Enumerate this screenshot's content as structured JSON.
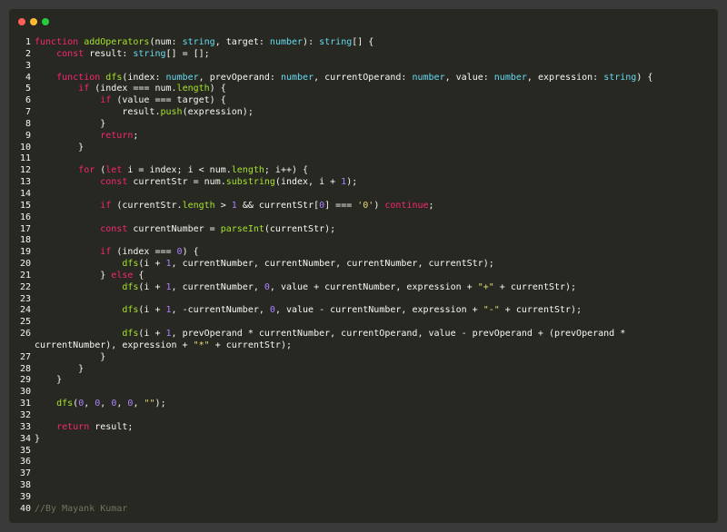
{
  "window": {
    "controls": [
      "close",
      "minimize",
      "maximize"
    ]
  },
  "code": {
    "lines": [
      {
        "n": "1",
        "t": "function addOperators(num: string, target: number): string[] {"
      },
      {
        "n": "2",
        "t": "    const result: string[] = [];"
      },
      {
        "n": "3",
        "t": ""
      },
      {
        "n": "4",
        "t": "    function dfs(index: number, prevOperand: number, currentOperand: number, value: number, expression: string) {"
      },
      {
        "n": "5",
        "t": "        if (index === num.length) {"
      },
      {
        "n": "6",
        "t": "            if (value === target) {"
      },
      {
        "n": "7",
        "t": "                result.push(expression);"
      },
      {
        "n": "8",
        "t": "            }"
      },
      {
        "n": "9",
        "t": "            return;"
      },
      {
        "n": "10",
        "t": "        }"
      },
      {
        "n": "11",
        "t": ""
      },
      {
        "n": "12",
        "t": "        for (let i = index; i < num.length; i++) {"
      },
      {
        "n": "13",
        "t": "            const currentStr = num.substring(index, i + 1);"
      },
      {
        "n": "14",
        "t": ""
      },
      {
        "n": "15",
        "t": "            if (currentStr.length > 1 && currentStr[0] === '0') continue;"
      },
      {
        "n": "16",
        "t": ""
      },
      {
        "n": "17",
        "t": "            const currentNumber = parseInt(currentStr);"
      },
      {
        "n": "18",
        "t": ""
      },
      {
        "n": "19",
        "t": "            if (index === 0) {"
      },
      {
        "n": "20",
        "t": "                dfs(i + 1, currentNumber, currentNumber, currentNumber, currentStr);"
      },
      {
        "n": "21",
        "t": "            } else {"
      },
      {
        "n": "22",
        "t": "                dfs(i + 1, currentNumber, 0, value + currentNumber, expression + \"+\" + currentStr);"
      },
      {
        "n": "23",
        "t": ""
      },
      {
        "n": "24",
        "t": "                dfs(i + 1, -currentNumber, 0, value - currentNumber, expression + \"-\" + currentStr);"
      },
      {
        "n": "25",
        "t": ""
      },
      {
        "n": "26",
        "t": "                dfs(i + 1, prevOperand * currentNumber, currentOperand, value - prevOperand + (prevOperand *"
      },
      {
        "n": "",
        "t": "currentNumber), expression + \"*\" + currentStr);"
      },
      {
        "n": "27",
        "t": "            }"
      },
      {
        "n": "28",
        "t": "        }"
      },
      {
        "n": "29",
        "t": "    }"
      },
      {
        "n": "30",
        "t": ""
      },
      {
        "n": "31",
        "t": "    dfs(0, 0, 0, 0, \"\");"
      },
      {
        "n": "32",
        "t": ""
      },
      {
        "n": "33",
        "t": "    return result;"
      },
      {
        "n": "34",
        "t": "}"
      },
      {
        "n": "35",
        "t": ""
      },
      {
        "n": "36",
        "t": ""
      },
      {
        "n": "37",
        "t": ""
      },
      {
        "n": "38",
        "t": ""
      },
      {
        "n": "39",
        "t": ""
      },
      {
        "n": "40",
        "t": "//By Mayank Kumar"
      }
    ]
  }
}
